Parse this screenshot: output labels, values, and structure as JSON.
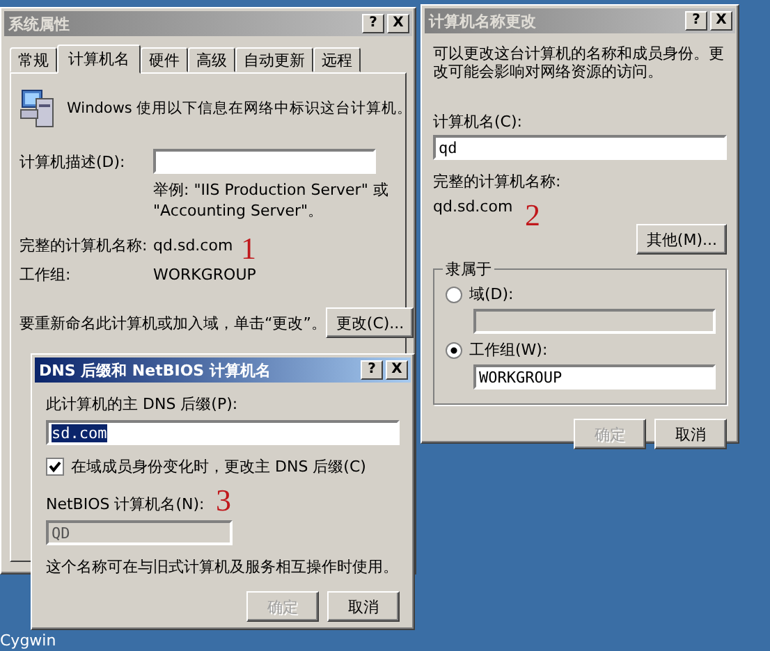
{
  "system_properties": {
    "title": "系统属性",
    "active": false,
    "title_buttons": [
      "?",
      "X"
    ],
    "tabs": [
      {
        "label": "常规",
        "selected": false
      },
      {
        "label": "计算机名",
        "selected": true
      },
      {
        "label": "硬件",
        "selected": false
      },
      {
        "label": "高级",
        "selected": false
      },
      {
        "label": "自动更新",
        "selected": false
      },
      {
        "label": "远程",
        "selected": false
      }
    ],
    "intro": "Windows 使用以下信息在网络中标识这台计算机。",
    "description_label": "计算机描述(D):",
    "description_hint": "举例: \"IIS Production Server\" 或 \"Accounting Server\"。",
    "full_name_label": "完整的计算机名称:",
    "full_name": "qd.sd.com",
    "workgroup_label": "工作组:",
    "workgroup": "WORKGROUP",
    "rename_text": "要重新命名此计算机或加入域，单击“更改”。",
    "change_button": "更改(C)...",
    "annotation": "1"
  },
  "computer_name_changes": {
    "title": "计算机名称更改",
    "active": false,
    "title_buttons": [
      "?",
      "X"
    ],
    "intro": "可以更改这台计算机的名称和成员身份。更改可能会影响对网络资源的访问。",
    "name_label": "计算机名(C):",
    "name_value": "qd",
    "full_name_label": "完整的计算机名称:",
    "full_name": "qd.sd.com",
    "more_button": "其他(M)...",
    "member_of": {
      "legend": "隶属于",
      "options": [
        {
          "label": "域(D):",
          "selected": false,
          "disabled": true
        },
        {
          "label": "工作组(W):",
          "selected": true,
          "value": "WORKGROUP",
          "disabled": false
        }
      ]
    },
    "buttons": [
      {
        "label": "确定",
        "disabled": true
      },
      {
        "label": "取消",
        "disabled": false
      }
    ],
    "annotation": "2"
  },
  "dns_suffix_dialog": {
    "title": "DNS 后缀和 NetBIOS 计算机名",
    "active": true,
    "title_buttons": [
      "?",
      "X"
    ],
    "suffix_label": "此计算机的主 DNS 后缀(P):",
    "suffix_value": "sd.com",
    "change_suffix": {
      "label": "在域成员身份变化时，更改主 DNS 后缀(C)",
      "checked": true
    },
    "netbios_label": "NetBIOS 计算机名(N):",
    "netbios_value": "QD",
    "note": "这个名称可在与旧式计算机及服务相互操作时使用。",
    "buttons": [
      {
        "label": "确定",
        "disabled": true
      },
      {
        "label": "取消",
        "disabled": false
      }
    ],
    "annotation": "3"
  },
  "desktop": {
    "icons": [
      {
        "label": "Cygwin"
      }
    ]
  }
}
